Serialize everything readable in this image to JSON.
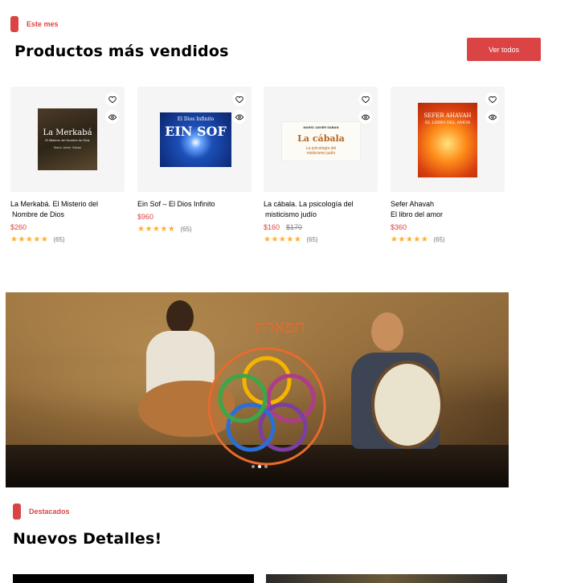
{
  "best_sellers": {
    "tag": "Este mes",
    "title": "Productos más vendidos",
    "view_all": "Ver todos"
  },
  "products": [
    {
      "name_line1": "La Merkabá. El Misterio del",
      "name_line2": "Nombre de Dios",
      "price": "$260",
      "old_price": "",
      "stars": "★★★★★",
      "reviews": "(65)",
      "cover_title": "La Merkabá",
      "cover_subtitle": "El Misterio del Nombre de Dios",
      "cover_author": "Mario Javier Saban"
    },
    {
      "name_line1": "Ein Sof – El Dios Infinito",
      "name_line2": "",
      "price": "$960",
      "old_price": "",
      "stars": "★★★★★",
      "reviews": "(65)",
      "cover_title": "EIN SOF",
      "cover_subtitle": "El Dios Infinito",
      "cover_author": ""
    },
    {
      "name_line1": "La cábala. La psicología del",
      "name_line2": "misticismo judío",
      "price": "$160",
      "old_price": "$170",
      "stars": "★★★★★",
      "reviews": "(65)",
      "cover_title": "La cábala",
      "cover_subtitle": "La psicología del misticismo judío",
      "cover_author": "MARIO JAVIER SABAN"
    },
    {
      "name_line1": "Sefer Ahavah",
      "name_line2": "El libro del amor",
      "price": "$360",
      "old_price": "",
      "stars": "★★★★★",
      "reviews": "(65)",
      "cover_title": "SEFER AHAVAH",
      "cover_subtitle": "EL LIBRO DEL AMOR",
      "cover_author": ""
    }
  ],
  "banner": {
    "logo_text": "תפארת",
    "slides": 3,
    "active_slide": 1
  },
  "featured": {
    "tag": "Destacados",
    "title": "Nuevos Detalles!"
  },
  "colors": {
    "accent": "#DB4444",
    "star": "#FFAD33",
    "card_bg": "#F5F5F5"
  },
  "icons": [
    "heart-icon",
    "eye-icon",
    "star-icon"
  ]
}
